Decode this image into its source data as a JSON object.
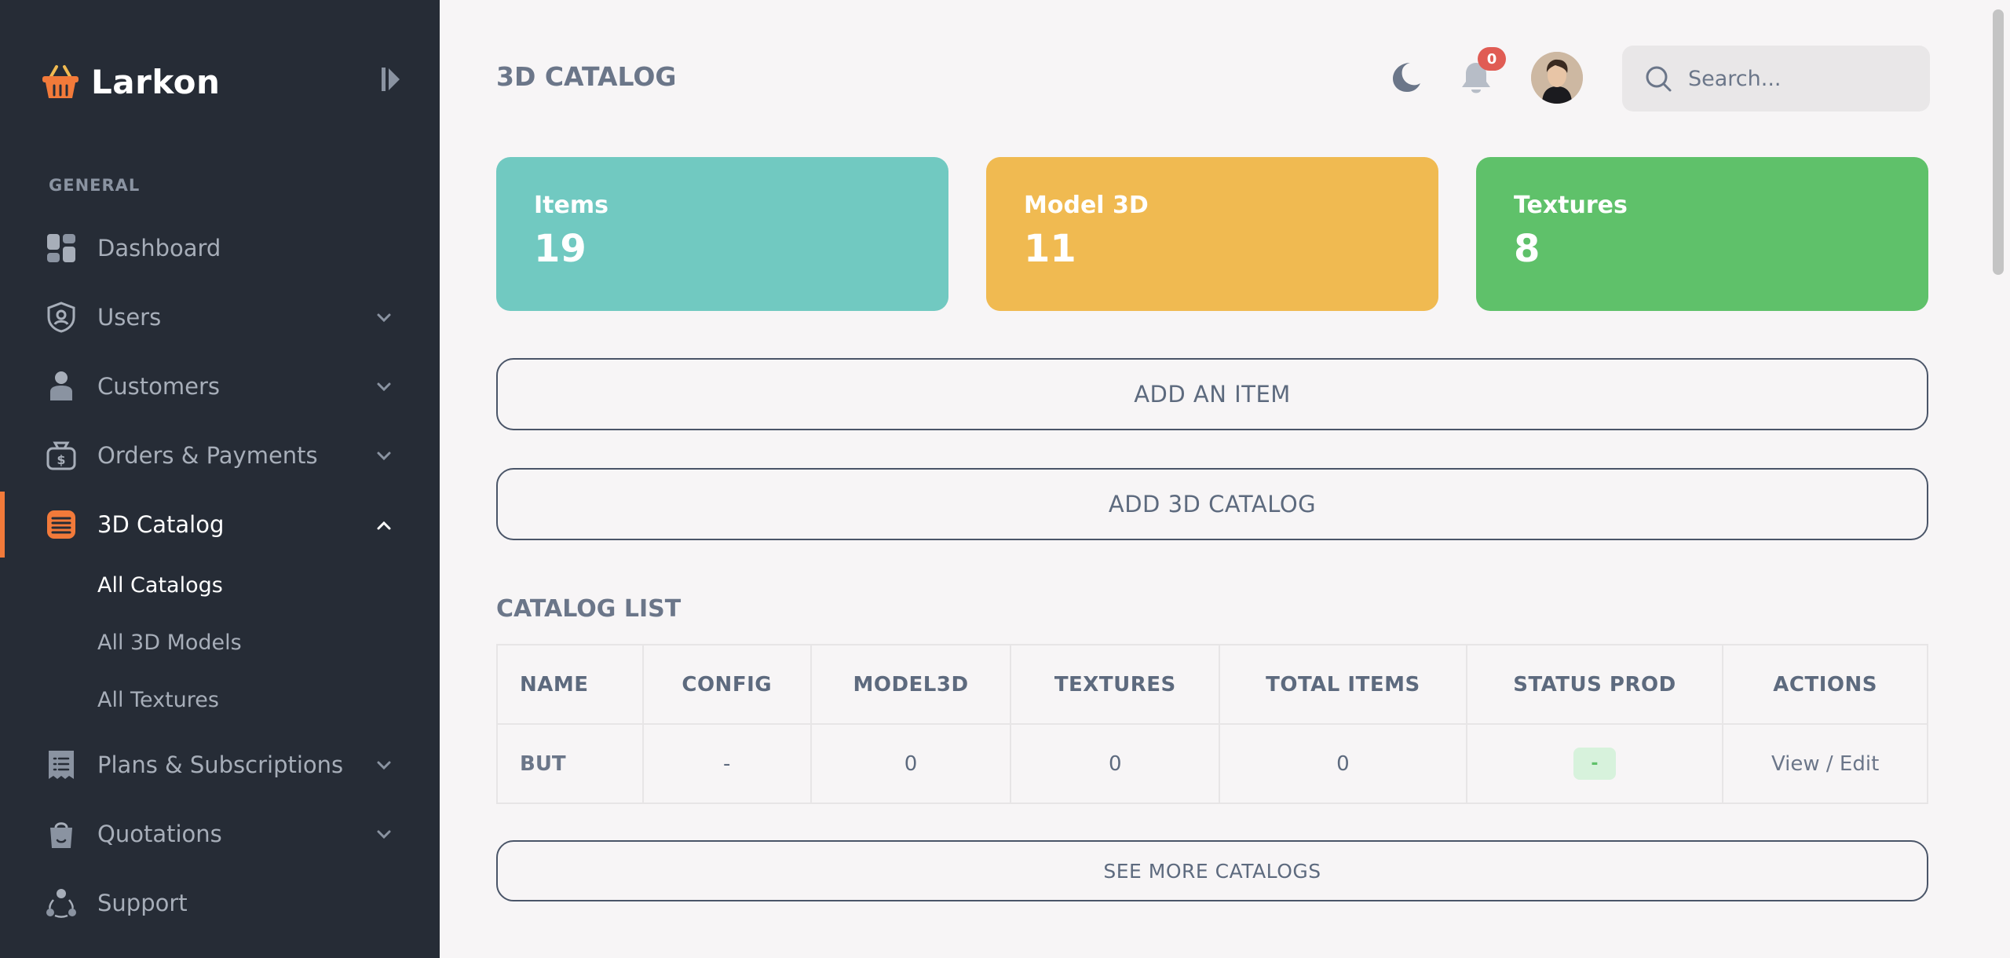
{
  "brand": {
    "name": "Larkon"
  },
  "sidebar": {
    "section_label": "GENERAL",
    "items": [
      {
        "label": "Dashboard",
        "icon": "dashboard-icon",
        "has_children": false
      },
      {
        "label": "Users",
        "icon": "user-shield-icon",
        "has_children": true
      },
      {
        "label": "Customers",
        "icon": "person-icon",
        "has_children": true
      },
      {
        "label": "Orders & Payments",
        "icon": "money-bag-icon",
        "has_children": true
      },
      {
        "label": "3D Catalog",
        "icon": "catalog-icon",
        "has_children": true,
        "active": true
      },
      {
        "label": "Plans & Subscriptions",
        "icon": "receipt-icon",
        "has_children": true
      },
      {
        "label": "Quotations",
        "icon": "shopping-bag-icon",
        "has_children": true
      },
      {
        "label": "Support",
        "icon": "support-icon",
        "has_children": false
      }
    ],
    "sub_items": [
      {
        "label": "All Catalogs",
        "active": true
      },
      {
        "label": "All 3D Models",
        "active": false
      },
      {
        "label": "All Textures",
        "active": false
      }
    ]
  },
  "header": {
    "title": "3D CATALOG",
    "notification_count": "0",
    "search_placeholder": "Search..."
  },
  "stats": [
    {
      "label": "Items",
      "value": "19",
      "color": "#71c9c1"
    },
    {
      "label": "Model 3D",
      "value": "11",
      "color": "#f0ba51"
    },
    {
      "label": "Textures",
      "value": "8",
      "color": "#5fc16a"
    }
  ],
  "buttons": {
    "add_item": "ADD AN ITEM",
    "add_catalog": "ADD 3D CATALOG",
    "see_more": "SEE MORE CATALOGS"
  },
  "catalog_list": {
    "title": "CATALOG LIST",
    "columns": [
      "NAME",
      "CONFIG",
      "MODEL3D",
      "TEXTURES",
      "TOTAL ITEMS",
      "STATUS PROD",
      "ACTIONS"
    ],
    "rows": [
      {
        "name": "BUT",
        "config": "-",
        "model3d": "0",
        "textures": "0",
        "total_items": "0",
        "status": "-",
        "actions": "View / Edit"
      }
    ]
  },
  "colors": {
    "sidebar_bg": "#262c36",
    "accent": "#f27a3a",
    "background": "#f7f5f6"
  }
}
